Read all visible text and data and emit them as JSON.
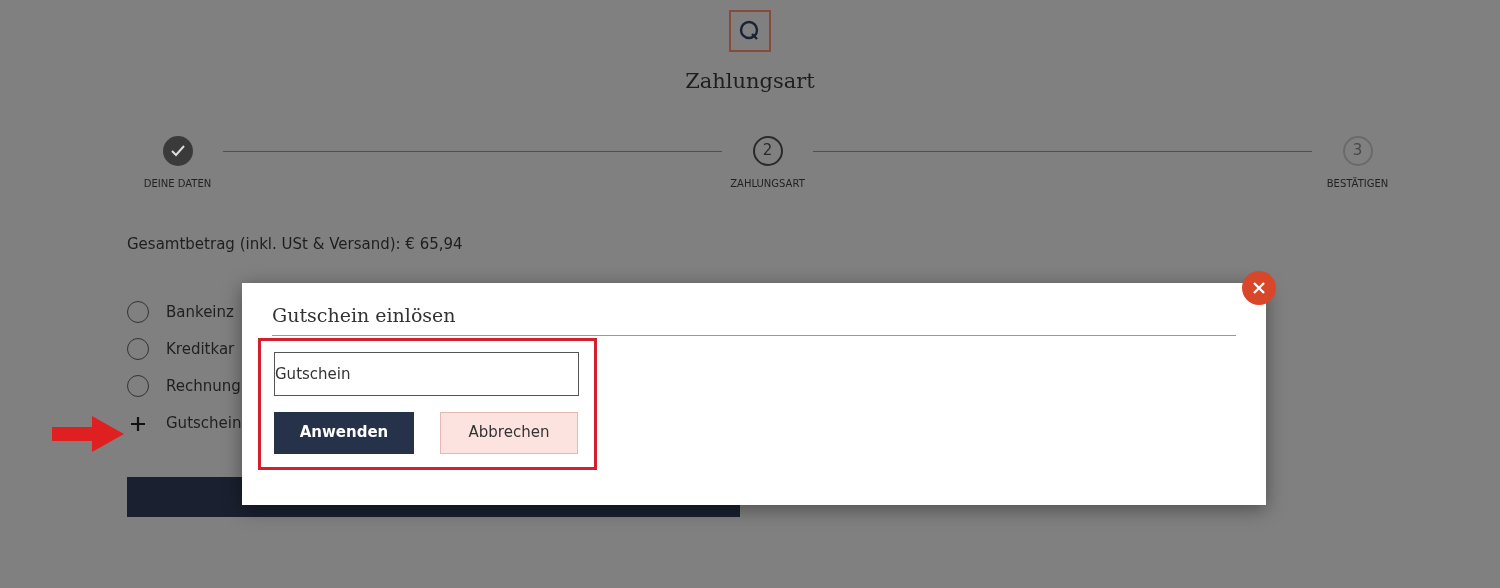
{
  "page": {
    "title": "Zahlungsart"
  },
  "steps": [
    {
      "label": "DEINE DATEN",
      "done": true,
      "selected": false
    },
    {
      "label": "ZAHLUNGSART",
      "number": "2",
      "done": false,
      "selected": true
    },
    {
      "label": "BESTÄTIGEN",
      "number": "3",
      "done": false,
      "selected": false
    }
  ],
  "total": "Gesamtbetrag (inkl. USt & Versand): € 65,94",
  "payment_options": [
    {
      "kind": "radio",
      "label": "Bankeinz",
      "selected": false
    },
    {
      "kind": "radio",
      "label": "Kreditkar",
      "selected": false
    },
    {
      "kind": "radio",
      "label": "Rechnung",
      "selected": false
    },
    {
      "kind": "expander",
      "label": "Gutschein",
      "expanded": false
    }
  ],
  "modal": {
    "title": "Gutschein einlösen",
    "field": {
      "placeholder": "Gutschein"
    },
    "buttons": [
      {
        "label": "Anwenden",
        "kind": "primary"
      },
      {
        "label": "Abbrechen",
        "kind": "secondary"
      }
    ]
  }
}
